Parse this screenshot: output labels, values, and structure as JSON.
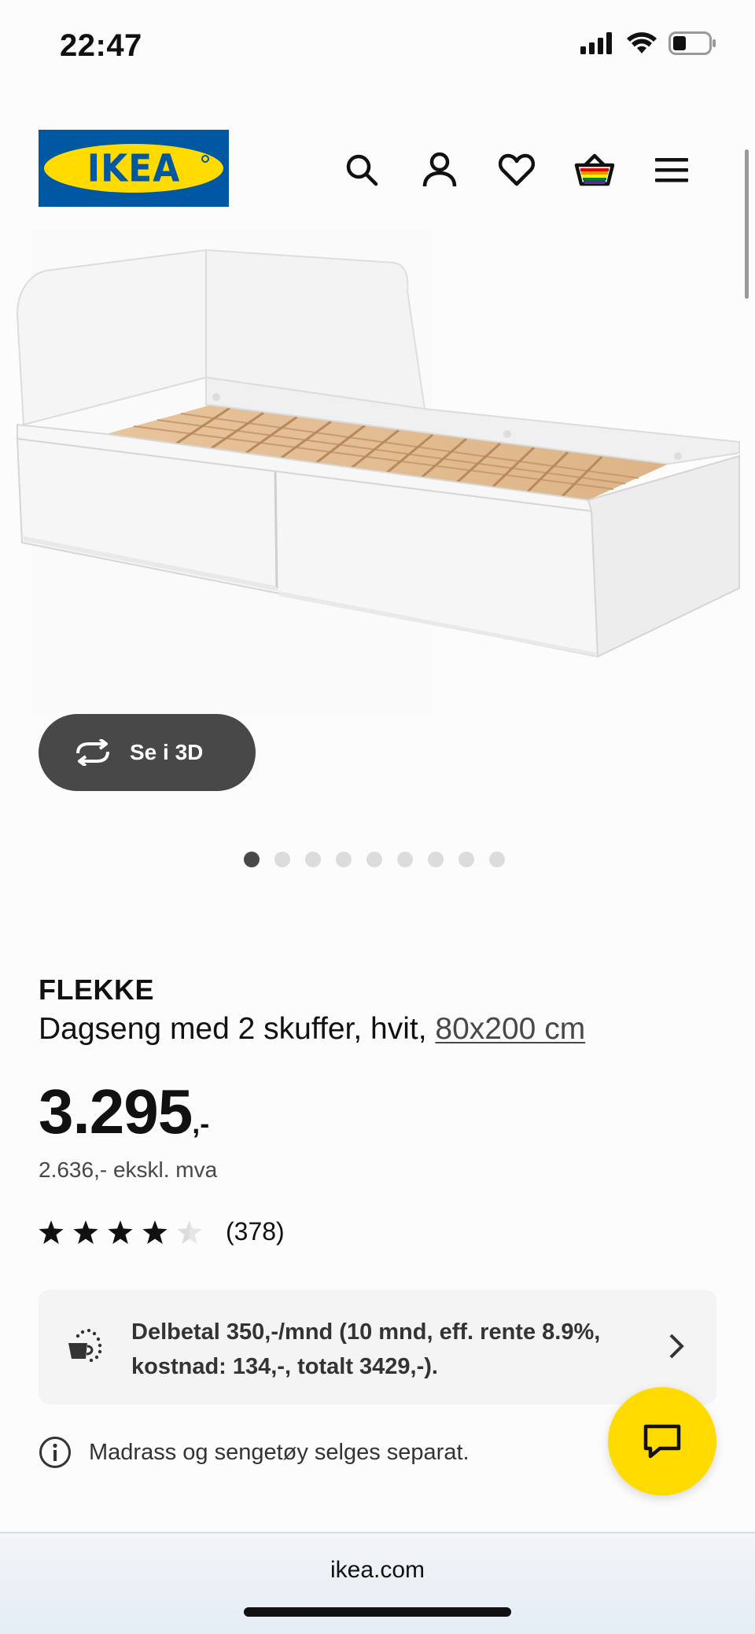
{
  "status_bar": {
    "time": "22:47"
  },
  "header": {
    "logo_text": "IKEA"
  },
  "product": {
    "view_3d_label": "Se i 3D",
    "carousel": {
      "total": 9,
      "active_index": 0
    },
    "name": "FLEKKE",
    "description": "Dagseng med 2 skuffer, hvit,",
    "size": "80x200 cm",
    "price_main": "3.295",
    "price_suffix": ",-",
    "price_excl_vat": "2.636,- ekskl. mva",
    "rating": {
      "value": 4,
      "max": 5,
      "count_label": "(378)"
    }
  },
  "finance": {
    "text": "Delbetal 350,-/mnd (10 mnd, eff. rente 8.9%, kostnad: 134,-, totalt 3429,-)."
  },
  "info_note": "Madrass og sengetøy selges separat.",
  "browser": {
    "url": "ikea.com"
  },
  "colors": {
    "brand_blue": "#0058a3",
    "brand_yellow": "#ffdb00",
    "button_dark": "#484848"
  }
}
